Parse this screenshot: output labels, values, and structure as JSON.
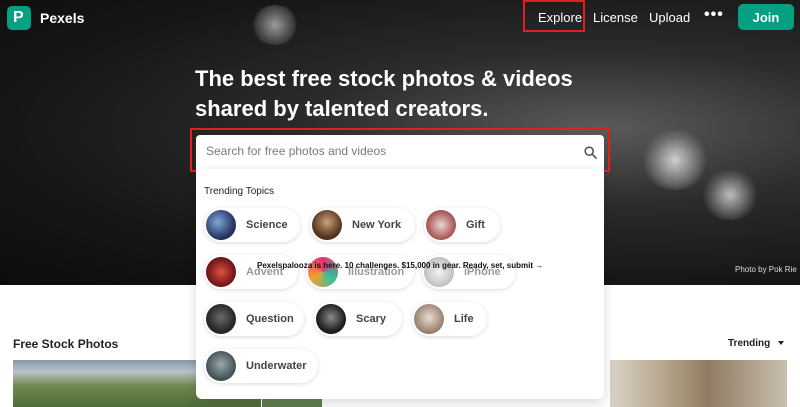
{
  "nav": {
    "logo_letter": "P",
    "brand": "Pexels",
    "explore": "Explore",
    "license": "License",
    "upload": "Upload",
    "more": "•••",
    "join": "Join"
  },
  "hero": {
    "headline_line1": "The best free stock photos & videos",
    "headline_line2": "shared by talented creators.",
    "photo_credit": "Photo by Pok Rie"
  },
  "search": {
    "placeholder": "Search for free photos and videos",
    "trending_title": "Trending Topics",
    "topics": [
      "Science",
      "New York",
      "Gift",
      "Advent",
      "Illustration",
      "iPhone",
      "Question",
      "Scary",
      "Life",
      "Underwater"
    ],
    "banner": "Pexelspalooza is here. 10 challenges. $15,000 in gear. Ready, set, submit →"
  },
  "section": {
    "title": "Free Stock Photos",
    "sort_label": "Trending"
  },
  "colors": {
    "brand": "#05a081",
    "highlight": "#e02020"
  }
}
